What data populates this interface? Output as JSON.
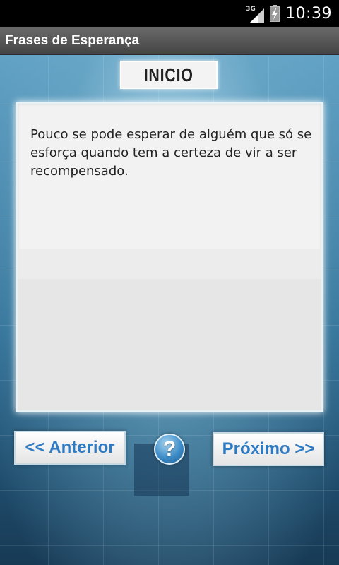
{
  "status_bar": {
    "network_type": "3G",
    "time": "10:39",
    "icons": [
      "signal-icon",
      "battery-charging-icon"
    ]
  },
  "app": {
    "title": "Frases de Esperança"
  },
  "main": {
    "top_button_label": "INICIO",
    "quote": "Pouco se pode esperar de alguém que só se esforça quando tem a certeza de vir a ser recompensado.",
    "prev_button_label": "<< Anterior",
    "next_button_label": "Próximo >>",
    "help_icon_glyph": "?"
  },
  "colors": {
    "button_text": "#2f7bc3",
    "title_bar": "#555555",
    "background_blue": "#4a8db5"
  }
}
